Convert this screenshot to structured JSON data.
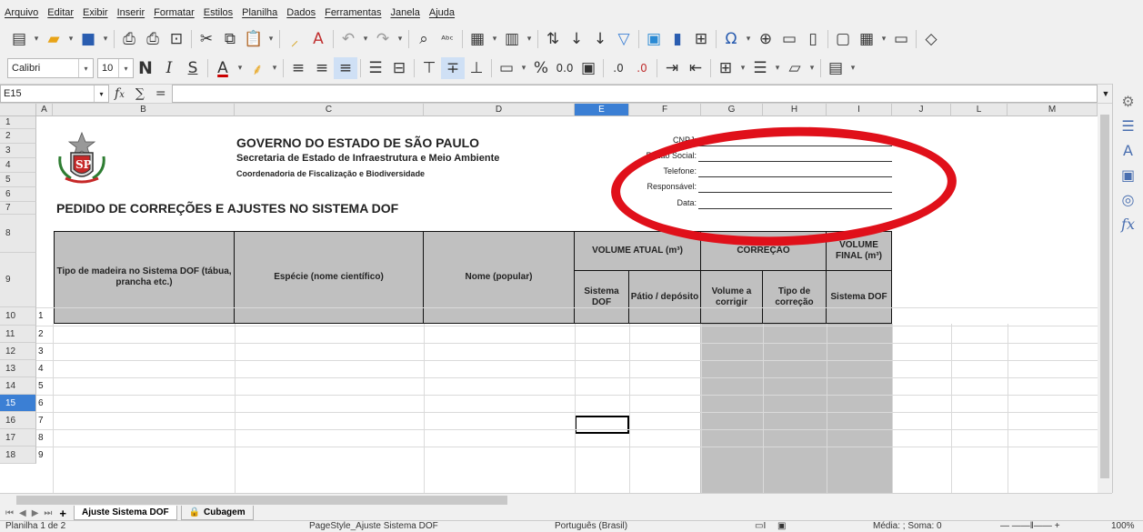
{
  "menu": [
    "Arquivo",
    "Editar",
    "Exibir",
    "Inserir",
    "Formatar",
    "Estilos",
    "Planilha",
    "Dados",
    "Ferramentas",
    "Janela",
    "Ajuda"
  ],
  "toolbar": {
    "font_name": "Calibri",
    "font_size": "10",
    "number_format_decimals": "0.0",
    "icons": [
      "new-icon",
      "open-icon",
      "save-icon",
      "export-pdf-icon",
      "print-icon",
      "print-preview-icon",
      "cut-icon",
      "copy-icon",
      "paste-icon",
      "clone-format-icon",
      "clear-format-icon",
      "undo-icon",
      "redo-icon",
      "find-replace-icon",
      "spelling-icon",
      "row-icon",
      "column-icon",
      "sort-icon",
      "sort-asc-icon",
      "sort-desc-icon",
      "autofilter-icon",
      "image-icon",
      "chart-icon",
      "pivot-icon",
      "special-char-icon",
      "hyperlink-icon",
      "comment-icon",
      "header-footer-icon",
      "define-print-area-icon",
      "freeze-icon",
      "split-icon",
      "show-draw-icon"
    ]
  },
  "formula_bar": {
    "cell_ref": "E15",
    "value": ""
  },
  "columns": [
    "A",
    "B",
    "C",
    "D",
    "E",
    "F",
    "G",
    "H",
    "I",
    "J",
    "L",
    "M"
  ],
  "rows": [
    "1",
    "2",
    "3",
    "4",
    "5",
    "6",
    "7",
    "8",
    "9",
    "10",
    "11",
    "12",
    "13",
    "14",
    "15",
    "16",
    "17",
    "18"
  ],
  "doc": {
    "gov_title": "GOVERNO DO ESTADO DE SÃO PAULO",
    "secretaria": "Secretaria de Estado de Infraestrutura e Meio Ambiente",
    "coordenadoria": "Coordenadoria de Fiscalização e Biodiversidade",
    "main_title": "PEDIDO DE CORREÇÕES E AJUSTES NO SISTEMA DOF",
    "fields": [
      "CNPJ:",
      "Razão Social:",
      "Telefone:",
      "Responsável:",
      "Data:"
    ],
    "table": {
      "tipo": "Tipo de madeira no Sistema DOF (tábua, prancha etc.)",
      "especie": "Espécie (nome científico)",
      "nome": "Nome (popular)",
      "volume_atual": "VOLUME ATUAL (m³)",
      "correcao": "CORREÇÃO",
      "volume_final": "VOLUME FINAL (m³)",
      "sistema_dof": "Sistema DOF",
      "patio": "Pátio / depósito",
      "volume_corrigir": "Volume a corrigir",
      "tipo_correcao": "Tipo de correção",
      "sistema_dof2": "Sistema DOF"
    },
    "item_numbers": [
      "1",
      "2",
      "3",
      "4",
      "5",
      "6",
      "7",
      "8",
      "9"
    ]
  },
  "sheet_tabs": [
    "Ajuste Sistema DOF",
    "Cubagem"
  ],
  "status": {
    "sheet": "Planilha 1 de 2",
    "page_style": "PageStyle_Ajuste Sistema DOF",
    "language": "Português (Brasil)",
    "summary": "Média: ; Soma: 0",
    "zoom": "100%"
  },
  "colors": {
    "accent": "#3b7fd4",
    "highlight_ellipse": "#e0101a",
    "header_fill": "#c0c0c0"
  }
}
